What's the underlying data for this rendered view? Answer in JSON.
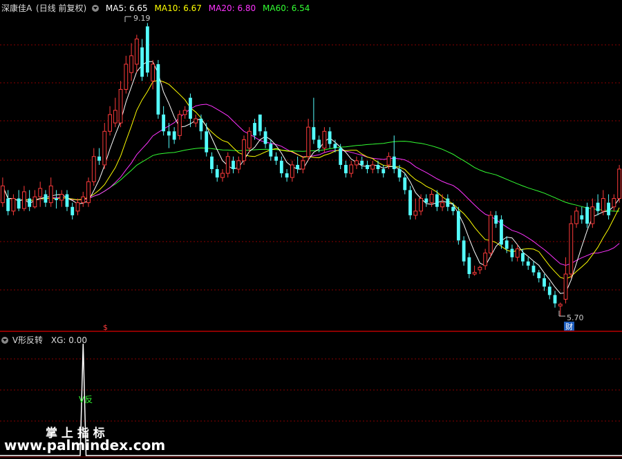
{
  "header": {
    "stock_name": "深康佳A",
    "mode": "(日线 前复权)",
    "ma5": "MA5: 6.65",
    "ma10": "MA10: 6.67",
    "ma20": "MA20: 6.80",
    "ma60": "MA60: 6.54"
  },
  "colors": {
    "up": "#ff3b3b",
    "down": "#54ffff",
    "ma5": "#ffffff",
    "ma10": "#ffff00",
    "ma20": "#ff33ff",
    "ma60": "#33ff33",
    "grid": "#8b0000"
  },
  "annotations": {
    "high_label": "9.19",
    "low_label": "5.70",
    "cai_badge": "财",
    "s_marker": "$"
  },
  "indicator": {
    "title": "V形反转",
    "xg": "XG: 0.00",
    "signal_label": "V反"
  },
  "watermark": {
    "line1": "掌 上 指 标",
    "line2": "www.palmindex.com"
  },
  "chart_data": [
    {
      "type": "candlestick",
      "title": "深康佳A (日线 前复权)",
      "ylim": [
        5.6,
        9.3
      ],
      "annotations": {
        "high": 9.19,
        "low": 5.7
      },
      "candles": [
        [
          7.05,
          7.25,
          7.0,
          7.35
        ],
        [
          7.1,
          6.95,
          6.9,
          7.2
        ],
        [
          6.95,
          7.1,
          6.9,
          7.15
        ],
        [
          7.1,
          6.98,
          6.95,
          7.2
        ],
        [
          6.98,
          7.18,
          6.95,
          7.25
        ],
        [
          7.1,
          7.0,
          6.95,
          7.2
        ],
        [
          7.0,
          7.12,
          6.98,
          7.2
        ],
        [
          7.12,
          7.22,
          7.0,
          7.3
        ],
        [
          7.15,
          7.05,
          7.0,
          7.2
        ],
        [
          7.05,
          7.25,
          7.0,
          7.35
        ],
        [
          7.1,
          7.08,
          6.98,
          7.2
        ],
        [
          7.08,
          7.15,
          7.0,
          7.2
        ],
        [
          7.15,
          7.0,
          6.95,
          7.2
        ],
        [
          7.0,
          6.9,
          6.85,
          7.05
        ],
        [
          6.95,
          7.05,
          6.9,
          7.1
        ],
        [
          7.05,
          7.12,
          7.0,
          7.18
        ],
        [
          7.05,
          7.3,
          7.0,
          7.35
        ],
        [
          7.3,
          7.6,
          7.25,
          7.7
        ],
        [
          7.6,
          7.55,
          7.5,
          7.7
        ],
        [
          7.5,
          7.9,
          7.45,
          8.0
        ],
        [
          7.9,
          8.1,
          7.85,
          8.2
        ],
        [
          8.0,
          8.15,
          7.95,
          8.3
        ],
        [
          8.0,
          8.4,
          7.95,
          8.5
        ],
        [
          8.4,
          8.7,
          8.35,
          8.8
        ],
        [
          8.6,
          8.8,
          8.5,
          8.95
        ],
        [
          8.7,
          9.0,
          8.6,
          9.05
        ],
        [
          8.9,
          8.55,
          8.5,
          9.0
        ],
        [
          9.15,
          8.6,
          8.55,
          9.19
        ],
        [
          8.5,
          8.7,
          8.4,
          8.75
        ],
        [
          8.7,
          8.1,
          8.05,
          8.75
        ],
        [
          8.1,
          7.9,
          7.85,
          8.2
        ],
        [
          7.9,
          7.85,
          7.7,
          8.0
        ],
        [
          7.9,
          7.8,
          7.75,
          7.95
        ],
        [
          7.85,
          8.1,
          7.8,
          8.15
        ],
        [
          8.1,
          8.15,
          8.05,
          8.2
        ],
        [
          8.3,
          8.05,
          7.95,
          8.35
        ],
        [
          8.0,
          8.05,
          7.95,
          8.1
        ],
        [
          8.05,
          7.9,
          7.8,
          8.1
        ],
        [
          7.9,
          7.65,
          7.6,
          8.0
        ],
        [
          7.6,
          7.45,
          7.4,
          7.65
        ],
        [
          7.45,
          7.35,
          7.3,
          7.5
        ],
        [
          7.35,
          7.4,
          7.3,
          7.45
        ],
        [
          7.4,
          7.6,
          7.35,
          7.65
        ],
        [
          7.55,
          7.45,
          7.4,
          7.6
        ],
        [
          7.45,
          7.55,
          7.4,
          7.6
        ],
        [
          7.55,
          7.8,
          7.5,
          7.85
        ],
        [
          7.7,
          7.9,
          7.65,
          7.95
        ],
        [
          8.0,
          7.85,
          7.8,
          8.05
        ],
        [
          8.1,
          7.9,
          7.85,
          8.1
        ],
        [
          7.9,
          7.75,
          7.7,
          7.95
        ],
        [
          7.75,
          7.6,
          7.55,
          7.8
        ],
        [
          7.6,
          7.55,
          7.5,
          7.65
        ],
        [
          7.55,
          7.4,
          7.35,
          7.6
        ],
        [
          7.4,
          7.35,
          7.3,
          7.45
        ],
        [
          7.35,
          7.5,
          7.3,
          7.55
        ],
        [
          7.5,
          7.45,
          7.4,
          7.6
        ],
        [
          7.45,
          7.55,
          7.4,
          7.6
        ],
        [
          7.6,
          7.95,
          7.55,
          8.05
        ],
        [
          7.95,
          7.8,
          7.75,
          8.3
        ],
        [
          7.8,
          7.7,
          7.65,
          7.85
        ],
        [
          7.7,
          7.9,
          7.65,
          7.95
        ],
        [
          7.9,
          7.75,
          7.7,
          7.95
        ],
        [
          7.75,
          7.7,
          7.65,
          7.8
        ],
        [
          7.7,
          7.5,
          7.45,
          7.75
        ],
        [
          7.5,
          7.4,
          7.35,
          7.55
        ],
        [
          7.4,
          7.5,
          7.35,
          7.55
        ],
        [
          7.5,
          7.55,
          7.45,
          7.6
        ],
        [
          7.55,
          7.5,
          7.45,
          7.6
        ],
        [
          7.5,
          7.45,
          7.4,
          7.55
        ],
        [
          7.45,
          7.5,
          7.4,
          7.55
        ],
        [
          7.5,
          7.45,
          7.4,
          7.55
        ],
        [
          7.45,
          7.4,
          7.35,
          7.5
        ],
        [
          7.5,
          7.6,
          7.45,
          7.65
        ],
        [
          7.6,
          7.45,
          7.4,
          7.85
        ],
        [
          7.45,
          7.35,
          7.3,
          7.5
        ],
        [
          7.35,
          7.2,
          7.15,
          7.4
        ],
        [
          7.2,
          6.9,
          6.85,
          7.25
        ],
        [
          6.9,
          6.95,
          6.85,
          7.1
        ],
        [
          6.95,
          7.1,
          6.9,
          7.15
        ],
        [
          7.1,
          7.05,
          7.0,
          7.15
        ],
        [
          7.05,
          7.15,
          7.0,
          7.2
        ],
        [
          7.15,
          7.0,
          6.95,
          7.2
        ],
        [
          7.0,
          7.05,
          6.95,
          7.15
        ],
        [
          7.1,
          7.0,
          6.95,
          7.15
        ],
        [
          7.0,
          6.95,
          6.9,
          7.05
        ],
        [
          6.95,
          6.6,
          6.55,
          7.0
        ],
        [
          6.6,
          6.35,
          6.3,
          6.65
        ],
        [
          6.4,
          6.2,
          6.15,
          6.45
        ],
        [
          6.2,
          6.22,
          6.18,
          6.3
        ],
        [
          6.25,
          6.28,
          6.2,
          6.3
        ],
        [
          6.3,
          6.45,
          6.25,
          6.5
        ],
        [
          6.45,
          6.9,
          6.4,
          6.95
        ],
        [
          6.9,
          6.8,
          6.75,
          6.95
        ],
        [
          6.85,
          6.55,
          6.5,
          6.9
        ],
        [
          6.6,
          6.5,
          6.45,
          6.65
        ],
        [
          6.5,
          6.4,
          6.35,
          6.55
        ],
        [
          6.4,
          6.5,
          6.35,
          6.55
        ],
        [
          6.45,
          6.35,
          6.3,
          6.5
        ],
        [
          6.35,
          6.3,
          6.25,
          6.4
        ],
        [
          6.3,
          6.22,
          6.18,
          6.35
        ],
        [
          6.22,
          6.15,
          6.1,
          6.25
        ],
        [
          6.15,
          6.05,
          6.0,
          6.2
        ],
        [
          6.05,
          5.95,
          5.9,
          6.1
        ],
        [
          5.95,
          5.85,
          5.8,
          6.0
        ],
        [
          5.82,
          5.84,
          5.7,
          5.86
        ],
        [
          5.9,
          6.2,
          5.85,
          6.4
        ],
        [
          6.2,
          6.8,
          6.15,
          6.9
        ],
        [
          6.8,
          6.95,
          6.75,
          7.0
        ],
        [
          6.9,
          6.85,
          6.8,
          7.0
        ],
        [
          7.0,
          6.8,
          6.75,
          7.05
        ],
        [
          6.8,
          7.0,
          6.75,
          7.1
        ],
        [
          7.05,
          6.95,
          6.9,
          7.15
        ],
        [
          6.95,
          7.1,
          6.9,
          7.2
        ],
        [
          7.05,
          6.9,
          6.85,
          7.15
        ],
        [
          7.0,
          7.1,
          6.95,
          7.15
        ],
        [
          7.1,
          7.45,
          7.05,
          7.5
        ]
      ]
    },
    {
      "type": "line",
      "title": "V形反转",
      "values": [
        0,
        0,
        0,
        0,
        0,
        0,
        0,
        0,
        0,
        0,
        0,
        0,
        0,
        0,
        0,
        0,
        0,
        0,
        0,
        0,
        0,
        0,
        0,
        0,
        0,
        0,
        0,
        0,
        0,
        0,
        0,
        0,
        0,
        0,
        0,
        0,
        0,
        0,
        0,
        0,
        0,
        0,
        0,
        0,
        0,
        0,
        0,
        0,
        0,
        0,
        0,
        0,
        0,
        0,
        0,
        0,
        0,
        0,
        0,
        0,
        0,
        0,
        0,
        0,
        0,
        0,
        0,
        0,
        0,
        0,
        0,
        0,
        0,
        0,
        0,
        0,
        0,
        0,
        0,
        0,
        0,
        0,
        0,
        0,
        0,
        0,
        0,
        0,
        0,
        0,
        0,
        0,
        0,
        0,
        0,
        0,
        0,
        0,
        0,
        0,
        0,
        0,
        0,
        0,
        0,
        0,
        0,
        0,
        0,
        0,
        0,
        0,
        0,
        0,
        0,
        0,
        0
      ],
      "spike": {
        "index": 15,
        "value": 1
      },
      "ylim": [
        0,
        1
      ]
    }
  ]
}
